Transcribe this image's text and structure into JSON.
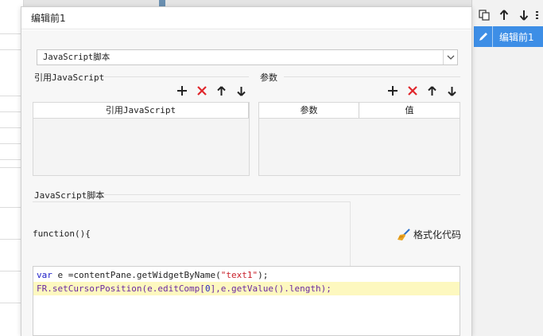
{
  "dialog": {
    "title": "编辑前1"
  },
  "script_type_select": {
    "value": "JavaScript脚本"
  },
  "references": {
    "label": "引用JavaScript",
    "column_header": "引用JavaScript",
    "rows": []
  },
  "parameters": {
    "label": "参数",
    "columns": [
      "参数",
      "值"
    ],
    "rows": []
  },
  "script_section": {
    "label": "JavaScript脚本",
    "function_header": "function(){",
    "format_button_label": "格式化代码"
  },
  "editor": {
    "line1": {
      "keyword": "var",
      "pre": " e =contentPane.getWidgetByName(",
      "string": "\"text1\"",
      "post": ");"
    },
    "line2": {
      "obj": "FR",
      "call": ".setCursorPosition(e.editComp[",
      "index": "0",
      "rest": "],e.getValue().length);"
    }
  },
  "right_panel": {
    "items": [
      {
        "label": "编辑前1",
        "selected": true
      }
    ]
  },
  "colors": {
    "selection_blue": "#3d8ee6",
    "delete_red": "#e0262b",
    "highlight_yellow": "#fdf8bf"
  }
}
